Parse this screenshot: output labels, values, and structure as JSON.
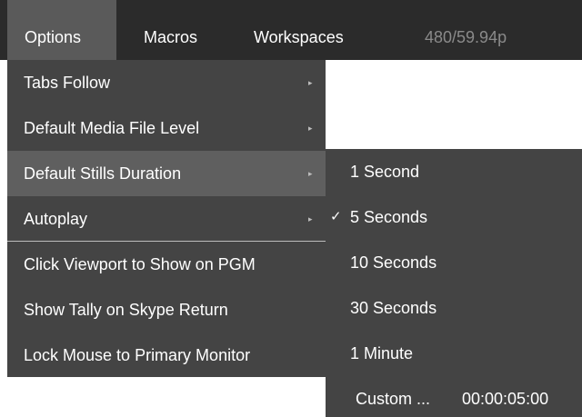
{
  "menubar": {
    "items": [
      {
        "label": "Options"
      },
      {
        "label": "Macros"
      },
      {
        "label": "Workspaces"
      }
    ],
    "format": "480/59.94p"
  },
  "options_menu": {
    "items": [
      {
        "label": "Tabs Follow"
      },
      {
        "label": "Default Media File Level"
      },
      {
        "label": "Default Stills Duration"
      },
      {
        "label": "Autoplay"
      },
      {
        "label": "Click Viewport to Show on PGM"
      },
      {
        "label": "Show Tally on Skype Return"
      },
      {
        "label": "Lock Mouse to Primary Monitor"
      }
    ],
    "arrow_glyph": "▸"
  },
  "duration_submenu": {
    "items": [
      {
        "label": "1 Second"
      },
      {
        "label": "5 Seconds",
        "checked": true
      },
      {
        "label": "10 Seconds"
      },
      {
        "label": "30 Seconds"
      },
      {
        "label": "1 Minute"
      }
    ],
    "check_glyph": "✓",
    "custom_label": "Custom ...",
    "custom_value": "00:00:05:00"
  },
  "colors": {
    "menubar_bg": "#2b2b2b",
    "menubar_active": "#5a5a5a",
    "menu_bg": "#444444",
    "menu_highlight": "#5f5f5f"
  }
}
